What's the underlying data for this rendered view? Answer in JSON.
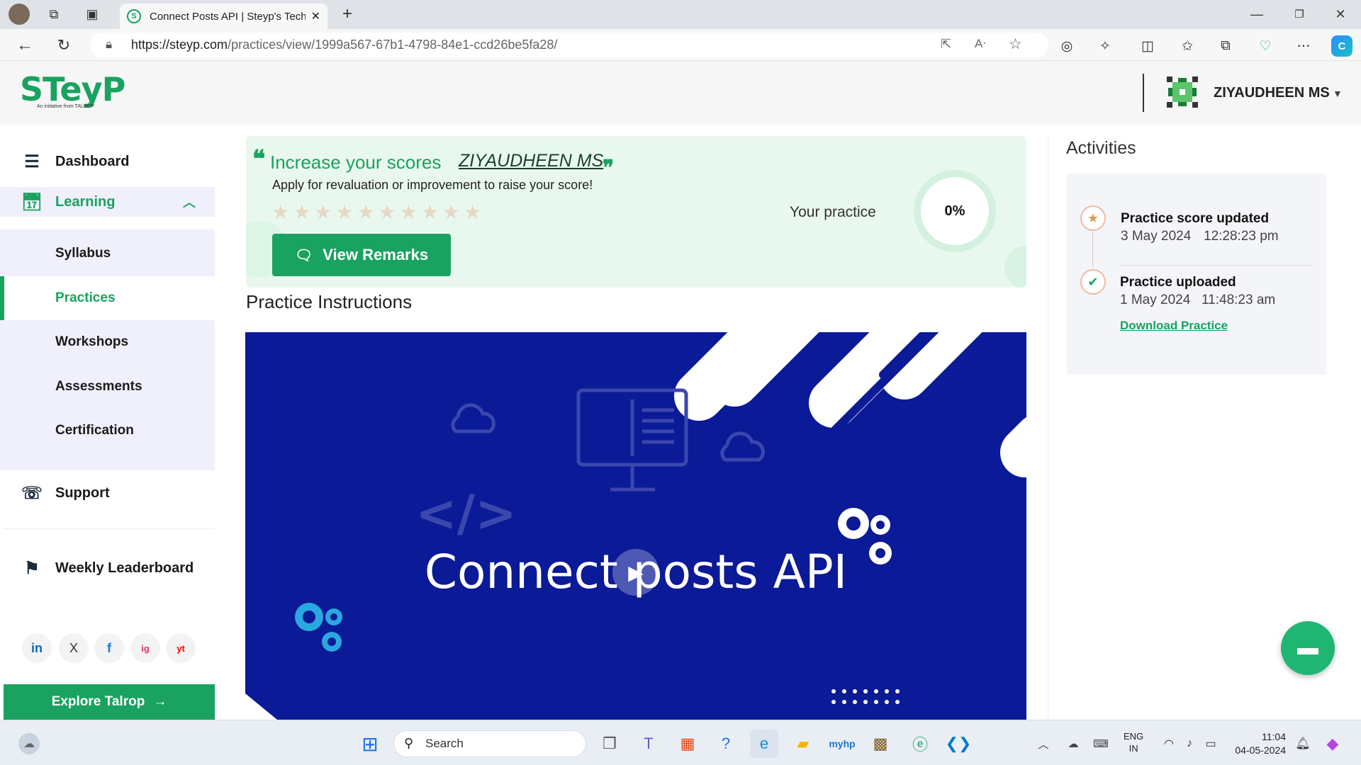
{
  "browser": {
    "tab_title": "Connect Posts API | Steyp's Tech",
    "url_host": "https://steyp.com",
    "url_path": "/practices/view/1999a567-67b1-4798-84e1-ccd26be5fa28/"
  },
  "header": {
    "logo": "STeyP",
    "logo_sub": "An initiative from TALROP",
    "username": "ZIYAUDHEEN MS"
  },
  "sidebar": {
    "dashboard": "Dashboard",
    "learning": "Learning",
    "sub_items": [
      "Syllabus",
      "Practices",
      "Workshops",
      "Assessments",
      "Certification"
    ],
    "support": "Support",
    "leaderboard": "Weekly Leaderboard",
    "social": [
      "in",
      "X",
      "f",
      "ig",
      "yt"
    ],
    "explore": "Explore Talrop"
  },
  "banner": {
    "headline": "Increase your scores",
    "name": "ZIYAUDHEEN MS",
    "subtext": "Apply for revaluation or improvement to raise your score!",
    "stars": "★★★★★★★★★★",
    "rating_count": 0,
    "remarks_button": "View Remarks",
    "your_practice": "Your practice",
    "percent": "0%"
  },
  "instructions": {
    "title": "Practice Instructions",
    "video_title": "Connect posts API"
  },
  "activities": {
    "title": "Activities",
    "items": [
      {
        "title": "Practice score updated",
        "date": "3 May 2024",
        "time": "12:28:23 pm"
      },
      {
        "title": "Practice uploaded",
        "date": "1 May 2024",
        "time": "11:48:23 am"
      }
    ],
    "download": "Download Practice"
  },
  "taskbar": {
    "search": "Search",
    "lang1": "ENG",
    "lang2": "IN",
    "time": "11:04",
    "date": "04-05-2024"
  },
  "colors": {
    "brand": "#1aa260",
    "video_bg": "#0b1a96",
    "submenu_bg": "#eff0fb"
  }
}
